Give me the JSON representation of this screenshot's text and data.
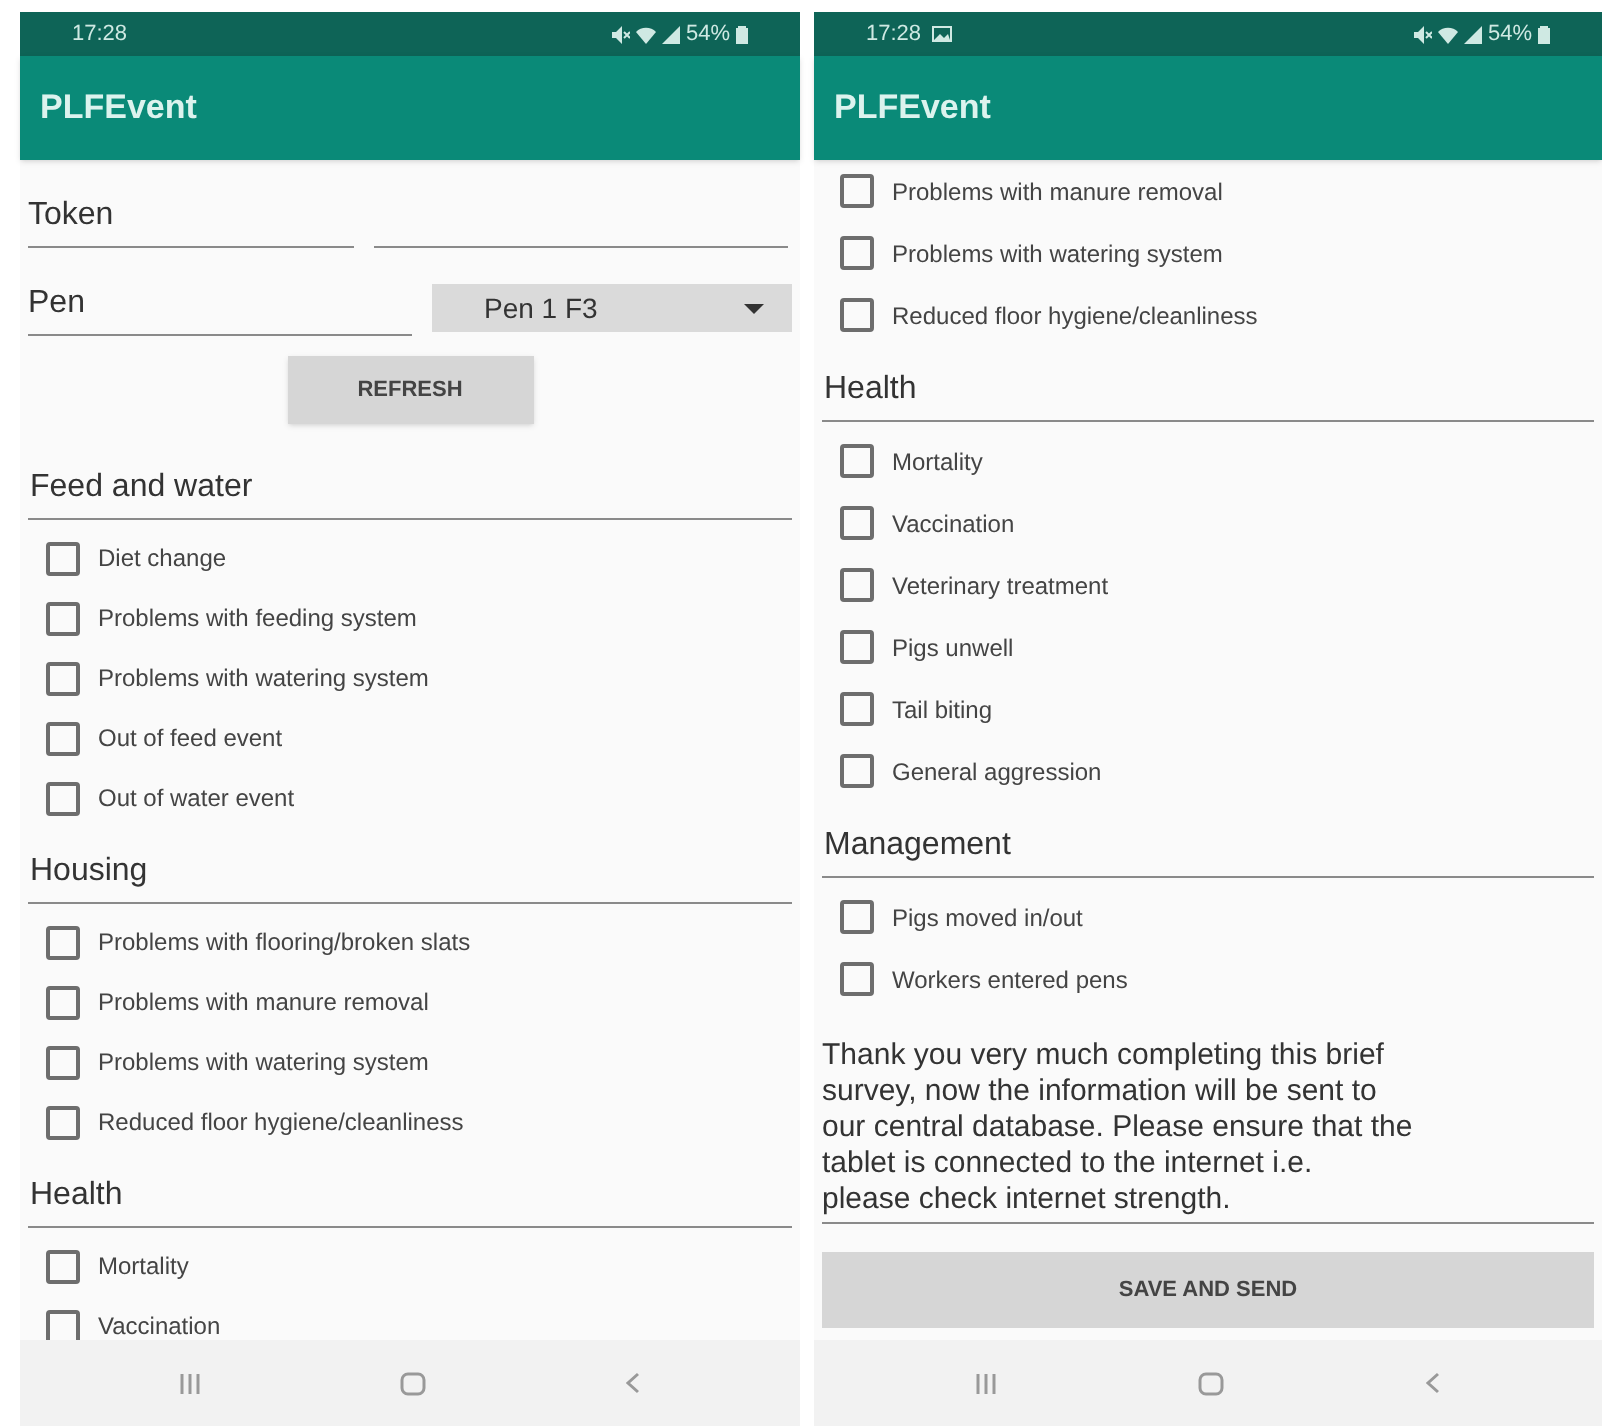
{
  "screens": [
    {
      "status_bar": {
        "time": "17:28",
        "battery": "54%",
        "notification": false
      },
      "app_bar": {
        "title": "PLFEvent"
      },
      "content": [
        {
          "kind": "field",
          "label": "Token"
        },
        {
          "kind": "dropdown",
          "label": "Pen",
          "value": "Pen 1 F3"
        },
        {
          "kind": "button",
          "label": "REFRESH"
        },
        {
          "kind": "heading",
          "label": "Feed and water"
        },
        {
          "kind": "checkbox",
          "label": "Diet change",
          "checked": false
        },
        {
          "kind": "checkbox",
          "label": "Problems with feeding system",
          "checked": false
        },
        {
          "kind": "checkbox",
          "label": "Problems with watering system",
          "checked": false
        },
        {
          "kind": "checkbox",
          "label": "Out of feed event",
          "checked": false
        },
        {
          "kind": "checkbox",
          "label": "Out of water event",
          "checked": false
        },
        {
          "kind": "heading",
          "label": "Housing"
        },
        {
          "kind": "checkbox",
          "label": "Problems with flooring/broken slats",
          "checked": false
        },
        {
          "kind": "checkbox",
          "label": "Problems with manure removal",
          "checked": false
        },
        {
          "kind": "checkbox",
          "label": "Problems with watering system",
          "checked": false
        },
        {
          "kind": "checkbox",
          "label": "Reduced floor hygiene/cleanliness",
          "checked": false
        },
        {
          "kind": "heading",
          "label": "Health"
        },
        {
          "kind": "checkbox",
          "label": "Mortality",
          "checked": false
        },
        {
          "kind": "checkbox",
          "label": "Vaccination",
          "checked": false
        }
      ]
    },
    {
      "status_bar": {
        "time": "17:28",
        "battery": "54%",
        "notification": true
      },
      "app_bar": {
        "title": "PLFEvent"
      },
      "content": [
        {
          "kind": "checkbox",
          "label": "Problems with manure removal",
          "checked": false
        },
        {
          "kind": "checkbox",
          "label": "Problems with watering system",
          "checked": false
        },
        {
          "kind": "checkbox",
          "label": "Reduced floor hygiene/cleanliness",
          "checked": false
        },
        {
          "kind": "heading",
          "label": "Health"
        },
        {
          "kind": "checkbox",
          "label": "Mortality",
          "checked": false
        },
        {
          "kind": "checkbox",
          "label": "Vaccination",
          "checked": false
        },
        {
          "kind": "checkbox",
          "label": "Veterinary treatment",
          "checked": false
        },
        {
          "kind": "checkbox",
          "label": "Pigs unwell",
          "checked": false
        },
        {
          "kind": "checkbox",
          "label": "Tail biting",
          "checked": false
        },
        {
          "kind": "checkbox",
          "label": "General aggression",
          "checked": false
        },
        {
          "kind": "heading",
          "label": "Management"
        },
        {
          "kind": "checkbox",
          "label": "Pigs moved in/out",
          "checked": false
        },
        {
          "kind": "checkbox",
          "label": "Workers entered pens",
          "checked": false
        },
        {
          "kind": "message",
          "lines": [
            "Thank you very much completing this brief",
            "survey, now the information will be sent to",
            "our central database. Please ensure that the",
            "tablet is connected to the internet i.e.",
            "please check internet strength."
          ]
        },
        {
          "kind": "wide_button",
          "label": "SAVE AND SEND"
        }
      ]
    }
  ]
}
